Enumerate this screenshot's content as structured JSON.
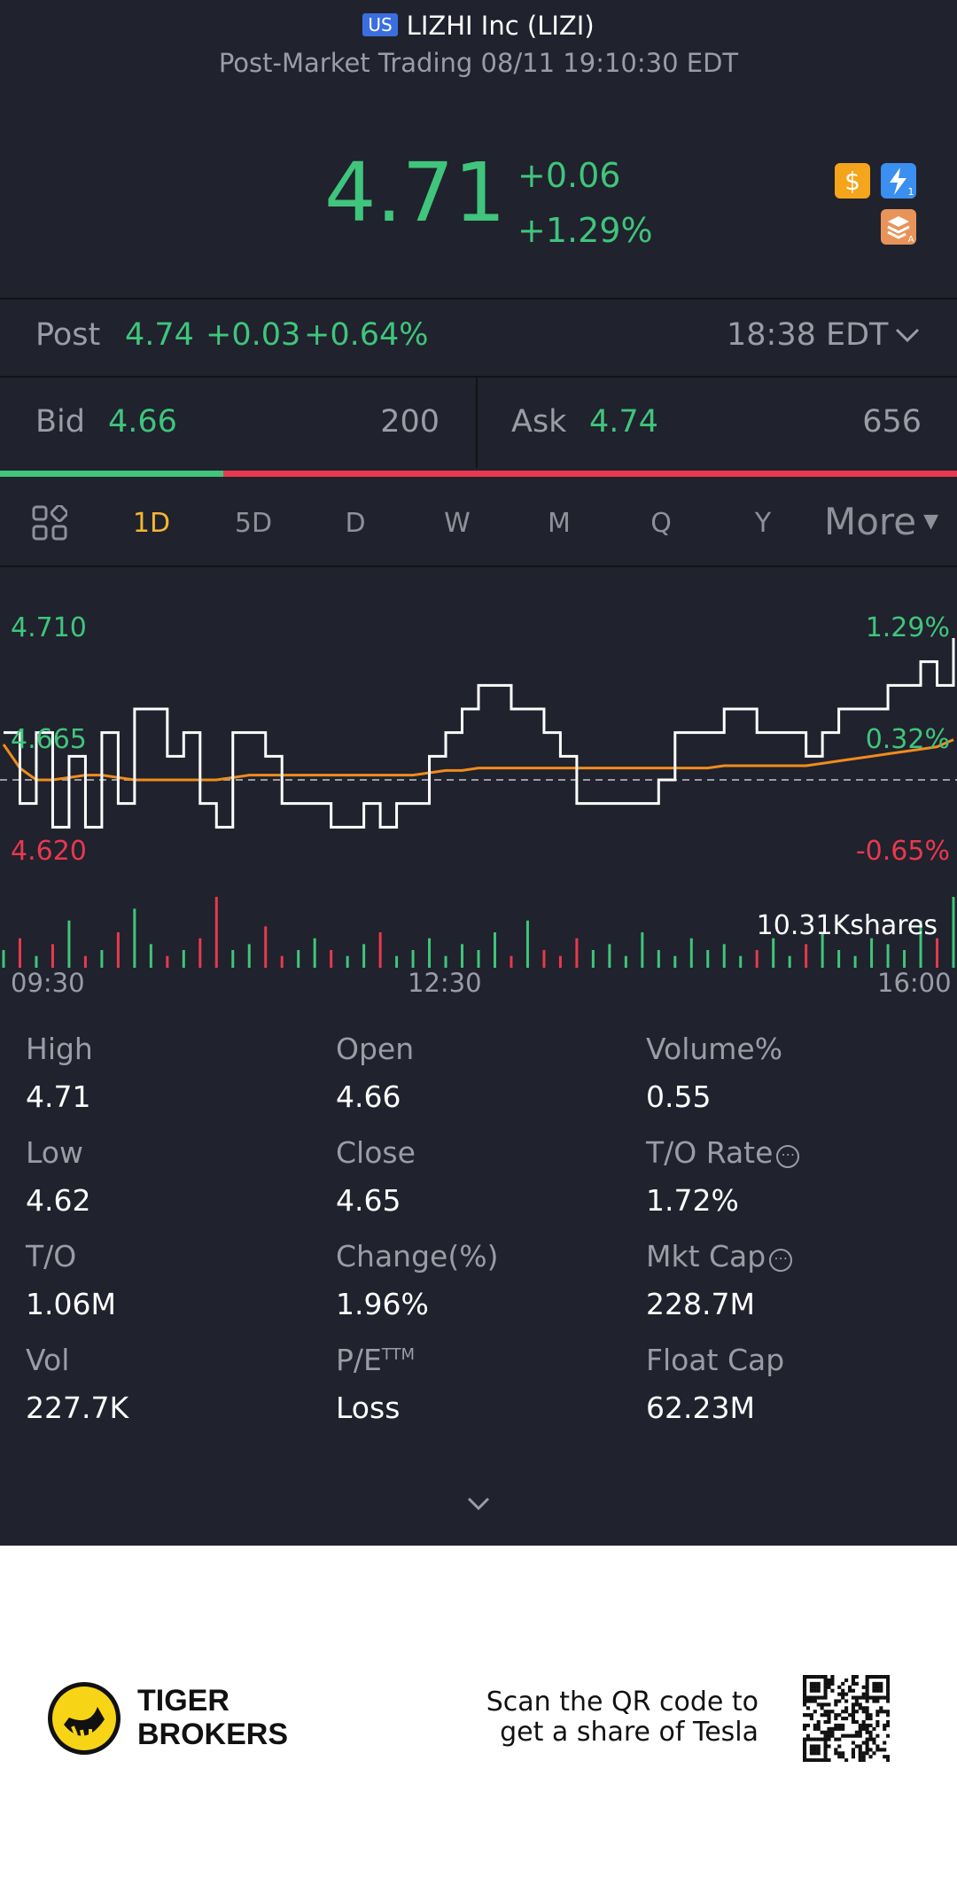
{
  "header": {
    "market_badge": "US",
    "stock_name": "LIZHI Inc (LIZI)",
    "session_status": "Post-Market Trading 08/11 19:10:30 EDT"
  },
  "quote": {
    "price": "4.71",
    "change": "+0.06",
    "change_pct": "+1.29%"
  },
  "post": {
    "label": "Post",
    "price": "4.74",
    "change": "+0.03",
    "change_pct": "+0.64%",
    "time": "18:38 EDT"
  },
  "bid": {
    "label": "Bid",
    "price": "4.66",
    "size": "200"
  },
  "ask": {
    "label": "Ask",
    "price": "4.74",
    "size": "656"
  },
  "bid_ask_ratio": 0.233,
  "timeframes": [
    "1D",
    "5D",
    "D",
    "W",
    "M",
    "Q",
    "Y"
  ],
  "timeframe_selected": "1D",
  "more_label": "More",
  "chart_data": {
    "type": "line",
    "y_left_ticks": [
      "4.710",
      "4.665",
      "4.620"
    ],
    "y_right_ticks": [
      "1.29%",
      "0.32%",
      "-0.65%"
    ],
    "x_ticks": [
      "09:30",
      "12:30",
      "16:00"
    ],
    "volume_label": "10.31Kshares",
    "ylim": [
      4.62,
      4.71
    ],
    "prev_close": 4.65,
    "price_series": [
      4.67,
      4.64,
      4.67,
      4.63,
      4.66,
      4.63,
      4.67,
      4.64,
      4.68,
      4.68,
      4.66,
      4.67,
      4.64,
      4.63,
      4.67,
      4.67,
      4.66,
      4.64,
      4.64,
      4.64,
      4.63,
      4.63,
      4.64,
      4.63,
      4.64,
      4.64,
      4.66,
      4.67,
      4.68,
      4.69,
      4.69,
      4.68,
      4.68,
      4.67,
      4.66,
      4.64,
      4.64,
      4.64,
      4.64,
      4.64,
      4.65,
      4.67,
      4.67,
      4.67,
      4.68,
      4.68,
      4.67,
      4.67,
      4.67,
      4.66,
      4.67,
      4.68,
      4.68,
      4.68,
      4.69,
      4.69,
      4.7,
      4.69,
      4.71
    ],
    "avg_series": [
      4.665,
      4.655,
      4.65,
      4.65,
      4.651,
      4.652,
      4.652,
      4.651,
      4.65,
      4.65,
      4.65,
      4.65,
      4.65,
      4.65,
      4.651,
      4.652,
      4.652,
      4.652,
      4.652,
      4.652,
      4.652,
      4.652,
      4.652,
      4.652,
      4.652,
      4.652,
      4.653,
      4.654,
      4.654,
      4.655,
      4.655,
      4.655,
      4.655,
      4.655,
      4.655,
      4.655,
      4.655,
      4.655,
      4.655,
      4.655,
      4.655,
      4.655,
      4.655,
      4.655,
      4.656,
      4.656,
      4.656,
      4.656,
      4.656,
      4.656,
      4.657,
      4.658,
      4.659,
      4.66,
      4.661,
      4.662,
      4.663,
      4.664,
      4.667
    ],
    "volume_series": [
      3,
      5,
      2,
      4,
      8,
      2,
      3,
      6,
      10,
      4,
      2,
      3,
      5,
      12,
      3,
      4,
      7,
      2,
      3,
      5,
      3,
      2,
      4,
      6,
      2,
      3,
      5,
      2,
      4,
      3,
      6,
      2,
      8,
      3,
      2,
      5,
      3,
      4,
      2,
      6,
      3,
      2,
      5,
      3,
      4,
      2,
      3,
      5,
      2,
      4,
      6,
      3,
      2,
      5,
      4,
      3,
      8,
      5,
      12
    ],
    "volume_max": 12
  },
  "stats": [
    {
      "label": "High",
      "value": "4.71"
    },
    {
      "label": "Open",
      "value": "4.66"
    },
    {
      "label": "Volume%",
      "value": "0.55"
    },
    {
      "label": "Low",
      "value": "4.62"
    },
    {
      "label": "Close",
      "value": "4.65"
    },
    {
      "label": "T/O Rate",
      "value": "1.72%"
    },
    {
      "label": "T/O",
      "value": "1.06M"
    },
    {
      "label": "Change(%)",
      "value": "1.96%"
    },
    {
      "label": "Mkt Cap",
      "value": "228.7M"
    },
    {
      "label": "Vol",
      "value": "227.7K"
    },
    {
      "label": "P/E",
      "value": "Loss"
    },
    {
      "label": "Float Cap",
      "value": "62.23M"
    }
  ],
  "pe_superscript": "TTM",
  "footer": {
    "brand_line1": "TIGER",
    "brand_line2": "BROKERS",
    "promo_line1": "Scan the QR code to",
    "promo_line2": "get a share of Tesla"
  },
  "colors": {
    "background": "#20222d",
    "up": "#3fc57c",
    "down": "#e8394f",
    "selected": "#f2b632",
    "avg_line": "#f08c1c"
  }
}
